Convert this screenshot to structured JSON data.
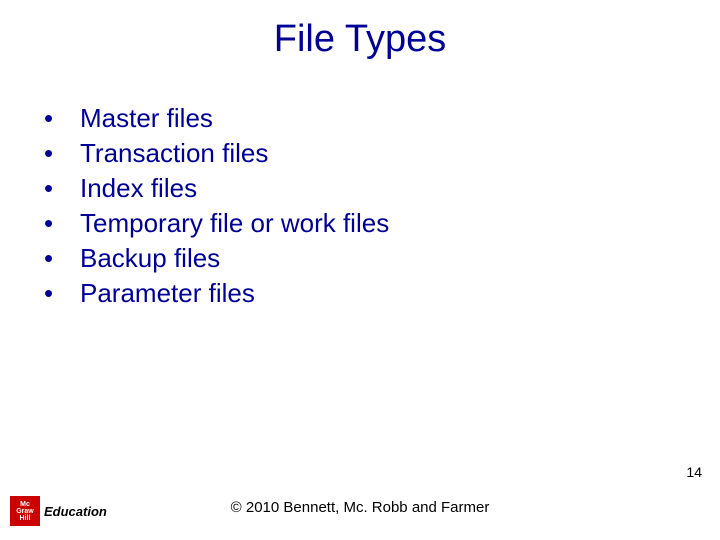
{
  "title": "File Types",
  "bullets": {
    "0": "Master files",
    "1": "Transaction files",
    "2": "Index files",
    "3": "Temporary file or work files",
    "4": "Backup files",
    "5": "Parameter files"
  },
  "slide_number": "14",
  "copyright": "© 2010 Bennett, Mc. Robb and Farmer",
  "logo": {
    "line1": "Mc",
    "line2": "Graw",
    "line3": "Hill",
    "text": "Education"
  }
}
